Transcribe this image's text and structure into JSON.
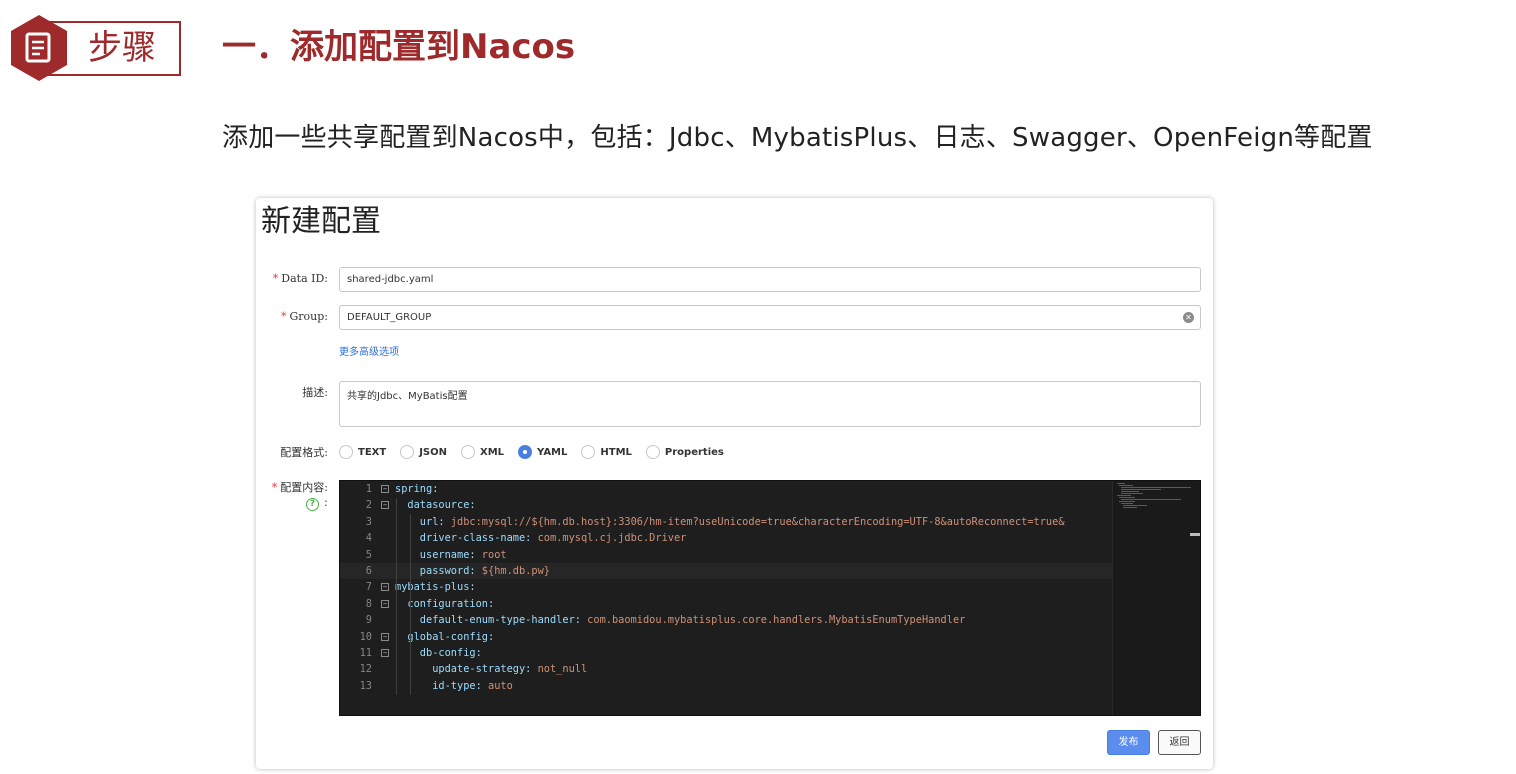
{
  "step": {
    "label": "步骤"
  },
  "slide": {
    "title": "一．添加配置到Nacos",
    "subtitle": "添加一些共享配置到Nacos中，包括：Jdbc、MybatisPlus、日志、Swagger、OpenFeign等配置"
  },
  "form": {
    "title": "新建配置",
    "data_id": {
      "label": "Data ID:",
      "value": "shared-jdbc.yaml"
    },
    "group": {
      "label": "Group:",
      "value": "DEFAULT_GROUP"
    },
    "advanced_link": "更多高级选项",
    "description": {
      "label": "描述:",
      "value": "共享的Jdbc、MyBatis配置"
    },
    "format": {
      "label": "配置格式:",
      "options": [
        "TEXT",
        "JSON",
        "XML",
        "YAML",
        "HTML",
        "Properties"
      ],
      "selected": "YAML"
    },
    "content_label": "配置内容:",
    "help_colon": ":",
    "code_lines": [
      {
        "n": "1",
        "key": "spring:",
        "val": ""
      },
      {
        "n": "2",
        "key": "  datasource:",
        "val": ""
      },
      {
        "n": "3",
        "key": "    url:",
        "val": " jdbc:mysql://${hm.db.host}:3306/hm-item?useUnicode=true&characterEncoding=UTF-8&autoReconnect=true&"
      },
      {
        "n": "4",
        "key": "    driver-class-name:",
        "val": " com.mysql.cj.jdbc.Driver"
      },
      {
        "n": "5",
        "key": "    username:",
        "val": " root"
      },
      {
        "n": "6",
        "key": "    password:",
        "val": " ${hm.db.pw}"
      },
      {
        "n": "7",
        "key": "mybatis-plus:",
        "val": ""
      },
      {
        "n": "8",
        "key": "  configuration:",
        "val": ""
      },
      {
        "n": "9",
        "key": "    default-enum-type-handler:",
        "val": " com.baomidou.mybatisplus.core.handlers.MybatisEnumTypeHandler"
      },
      {
        "n": "10",
        "key": "  global-config:",
        "val": ""
      },
      {
        "n": "11",
        "key": "    db-config:",
        "val": ""
      },
      {
        "n": "12",
        "key": "      update-strategy:",
        "val": " not_null"
      },
      {
        "n": "13",
        "key": "      id-type:",
        "val": " auto"
      }
    ],
    "buttons": {
      "publish": "发布",
      "back": "返回"
    }
  },
  "colors": {
    "brand": "#9e2a2b",
    "primary": "#5b8def",
    "link": "#2f6fdc",
    "editor_bg": "#1e1e1e"
  },
  "icons": {
    "step": "document-icon",
    "clear": "clear-icon",
    "help": "help-icon",
    "fold": "fold-icon"
  }
}
